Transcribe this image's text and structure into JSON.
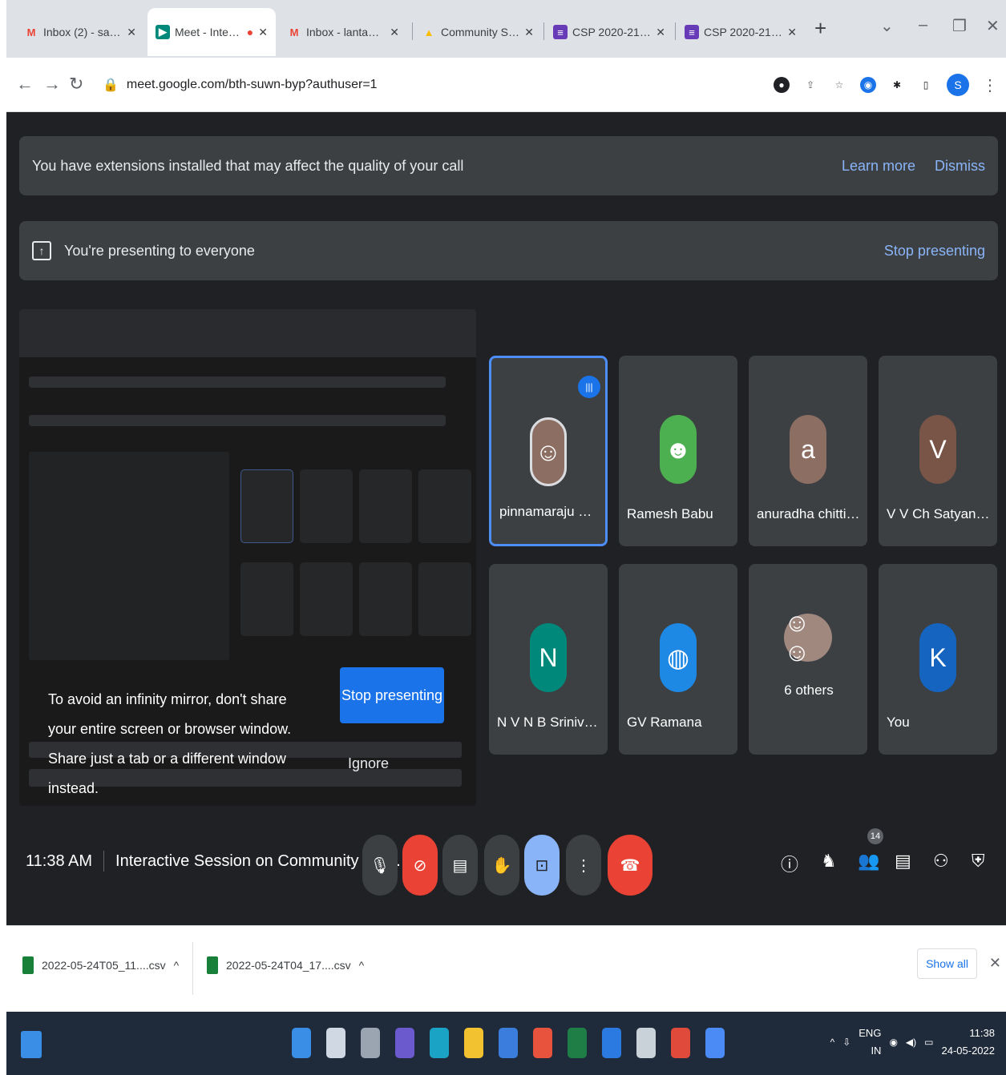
{
  "browser": {
    "tabs": [
      {
        "label": "Inbox (2) - saeu...",
        "favicon": "gmail-icon",
        "color": "#ea4335",
        "glyph": "M"
      },
      {
        "label": "Meet - Intera...",
        "favicon": "meet-icon",
        "color": "#00897b",
        "glyph": "▶",
        "active": true
      },
      {
        "label": "Inbox - lantamr...",
        "favicon": "gmail-icon",
        "color": "#ea4335",
        "glyph": "M"
      },
      {
        "label": "Community Serv...",
        "favicon": "drive-icon",
        "color": "#fbbc04",
        "glyph": "▲"
      },
      {
        "label": "CSP 2020-21 QU...",
        "favicon": "forms-icon",
        "color": "#673ab7",
        "glyph": "≡"
      },
      {
        "label": "CSP 2020-21 QU...",
        "favicon": "forms-icon",
        "color": "#673ab7",
        "glyph": "≡"
      }
    ],
    "new_tab": "+",
    "url": "meet.google.com/bth-suwn-byp?authuser=1",
    "profile_initial": "S"
  },
  "meet": {
    "extension_banner": {
      "text": "You have extensions installed that may affect the quality of your call",
      "learn_more": "Learn more",
      "dismiss": "Dismiss"
    },
    "presenting_banner": {
      "text": "You're presenting to everyone",
      "stop": "Stop presenting"
    },
    "share_overlay": {
      "message": "To avoid an infinity mirror, don't share your entire screen or browser window. Share just a tab or a different window instead.",
      "stop_button": "Stop presenting",
      "ignore_button": "Ignore"
    },
    "participants": [
      {
        "name": "pinnamaraju mad...",
        "avatar": "photo",
        "color": "#8d6e63",
        "speaking": true
      },
      {
        "name": "Ramesh Babu",
        "avatar": "photo",
        "color": "#4caf50"
      },
      {
        "name": "anuradha chittibo...",
        "avatar": "a",
        "color": "#8d6e63"
      },
      {
        "name": "V V Ch Satyanara...",
        "avatar": "V",
        "color": "#795548"
      },
      {
        "name": "N V N B Srinivasa ...",
        "avatar": "N",
        "color": "#00897b"
      },
      {
        "name": "GV Ramana",
        "avatar": "photo",
        "color": "#1e88e5"
      },
      {
        "name": "6 others",
        "avatar": "group",
        "color": "#a1887f"
      },
      {
        "name": "You",
        "avatar": "K",
        "color": "#1565c0"
      }
    ],
    "time": "11:38 AM",
    "meeting_title": "Interactive Session on Community Ser...",
    "participant_count": "14"
  },
  "downloads": {
    "items": [
      {
        "name": "2022-05-24T05_11....csv"
      },
      {
        "name": "2022-05-24T04_17....csv"
      }
    ],
    "show_all": "Show all"
  },
  "taskbar": {
    "lang": "ENG",
    "region": "IN",
    "time": "11:38",
    "date": "24-05-2022"
  }
}
